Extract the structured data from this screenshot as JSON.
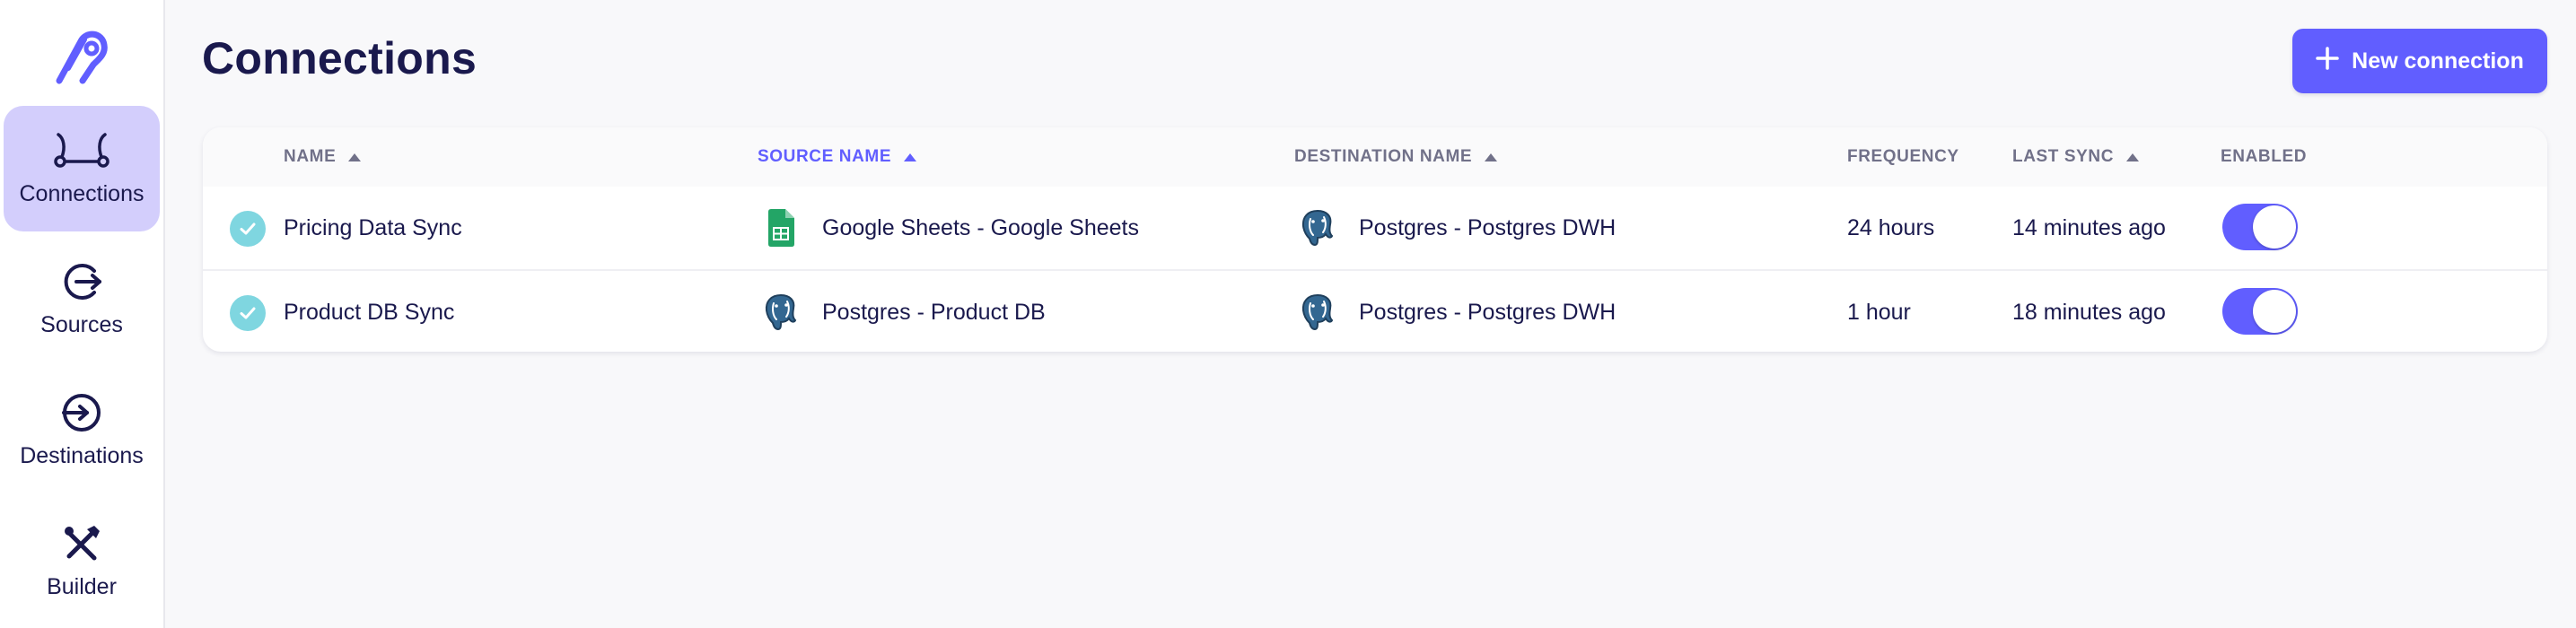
{
  "app": {
    "logo_icon": "airbyte-logo-icon",
    "accent_color": "#615eff"
  },
  "sidebar": {
    "items": [
      {
        "label": "Connections",
        "icon": "connections-icon",
        "active": true
      },
      {
        "label": "Sources",
        "icon": "sources-icon",
        "active": false
      },
      {
        "label": "Destinations",
        "icon": "destinations-icon",
        "active": false
      },
      {
        "label": "Builder",
        "icon": "builder-tools-icon",
        "active": false
      }
    ]
  },
  "header": {
    "title": "Connections",
    "new_button_label": "New connection",
    "new_button_icon": "plus-icon"
  },
  "table": {
    "columns": [
      {
        "label": "NAME",
        "sortable": true,
        "sorted": false
      },
      {
        "label": "SOURCE NAME",
        "sortable": true,
        "sorted": true
      },
      {
        "label": "DESTINATION NAME",
        "sortable": true,
        "sorted": false
      },
      {
        "label": "FREQUENCY",
        "sortable": false,
        "sorted": false
      },
      {
        "label": "LAST SYNC",
        "sortable": true,
        "sorted": false
      },
      {
        "label": "ENABLED",
        "sortable": false,
        "sorted": false
      }
    ],
    "rows": [
      {
        "status_icon": "check-circle-icon",
        "name": "Pricing Data Sync",
        "source": "Google Sheets - Google Sheets",
        "source_icon": "google-sheets-icon",
        "destination": "Postgres - Postgres DWH",
        "destination_icon": "postgres-icon",
        "frequency": "24 hours",
        "last_sync": "14 minutes ago",
        "enabled": true
      },
      {
        "status_icon": "check-circle-icon",
        "name": "Product DB Sync",
        "source": "Postgres - Product DB",
        "source_icon": "postgres-icon",
        "destination": "Postgres - Postgres DWH",
        "destination_icon": "postgres-icon",
        "frequency": "1 hour",
        "last_sync": "18 minutes ago",
        "enabled": true
      }
    ]
  }
}
